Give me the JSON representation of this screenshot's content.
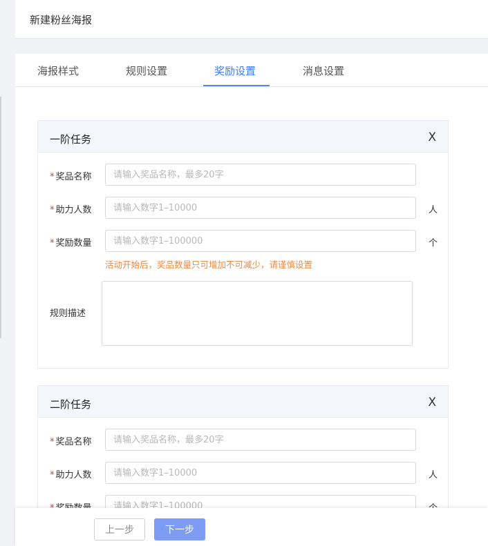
{
  "header": {
    "title": "新建粉丝海报"
  },
  "tabs": [
    {
      "label": "海报样式"
    },
    {
      "label": "规则设置"
    },
    {
      "label": "奖励设置"
    },
    {
      "label": "消息设置"
    }
  ],
  "colors": {
    "accent": "#3f7df7",
    "warning": "#f0883e",
    "required": "#e4393c",
    "primary_button": "#7f9cf5"
  },
  "tasks": [
    {
      "title": "一阶任务",
      "close": "X",
      "prize_name_label": "奖品名称",
      "prize_name_placeholder": "请输入奖品名称，最多20字",
      "helpers_label": "助力人数",
      "helpers_placeholder": "请输入数字1–10000",
      "helpers_unit": "人",
      "quantity_label": "奖励数量",
      "quantity_placeholder": "请输入数字1–100000",
      "quantity_unit": "个",
      "warning": "活动开始后，奖品数量只可增加不可减少，请谨慎设置",
      "rule_label": "规则描述"
    },
    {
      "title": "二阶任务",
      "close": "X",
      "prize_name_label": "奖品名称",
      "prize_name_placeholder": "请输入奖品名称，最多20字",
      "helpers_label": "助力人数",
      "helpers_placeholder": "请输入数字1–10000",
      "helpers_unit": "人",
      "quantity_label": "奖励数量",
      "quantity_placeholder": "请输入数字1–100000",
      "quantity_unit": "个"
    }
  ],
  "required_mark": "*",
  "footer": {
    "prev_label": "上一步",
    "next_label": "下一步"
  }
}
